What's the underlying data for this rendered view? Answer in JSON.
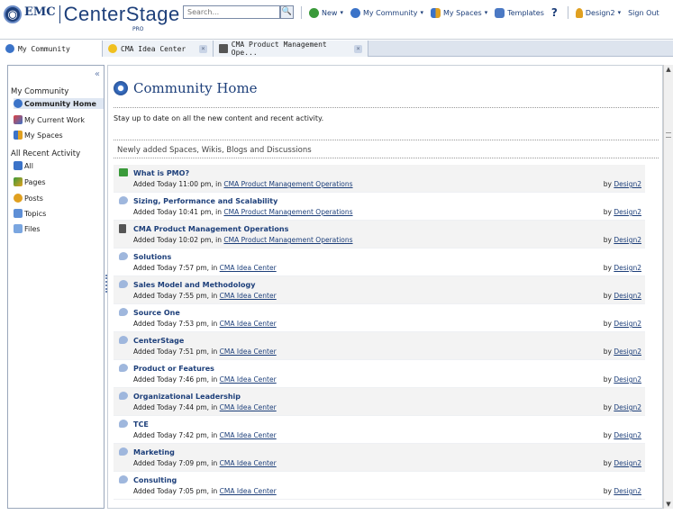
{
  "header": {
    "brand": "EMC",
    "product": "CenterStage",
    "edition": "PRO",
    "search_placeholder": "Search...",
    "search_button": "🔍",
    "nav": {
      "new": "New",
      "my_community": "My Community",
      "my_spaces": "My Spaces",
      "templates": "Templates",
      "help": "?",
      "user": "Design2",
      "sign_out": "Sign Out"
    }
  },
  "tabs": [
    {
      "label": "My Community"
    },
    {
      "label": "CMA Idea Center",
      "close": "×"
    },
    {
      "label": "CMA Product Management Ope...",
      "close": "×"
    }
  ],
  "sidebar": {
    "collapse": "«",
    "heading1": "My Community",
    "items1": [
      {
        "label": "Community Home"
      },
      {
        "label": "My Current Work"
      },
      {
        "label": "My Spaces"
      }
    ],
    "heading2": "All Recent Activity",
    "items2": [
      {
        "label": "All"
      },
      {
        "label": "Pages"
      },
      {
        "label": "Posts"
      },
      {
        "label": "Topics"
      },
      {
        "label": "Files"
      }
    ]
  },
  "main": {
    "title": "Community Home",
    "intro": "Stay up to date on all the new content and recent activity.",
    "section_title": "Newly added Spaces, Wikis, Blogs and Discussions",
    "rows": [
      {
        "title": "What is PMO?",
        "added": "Added Today 11:00 pm, in",
        "location": "CMA Product Management Operations",
        "by": "by",
        "author": "Design2"
      },
      {
        "title": "Sizing, Performance and Scalability",
        "added": "Added Today 10:41 pm, in",
        "location": "CMA Product Management Operations",
        "by": "by",
        "author": "Design2"
      },
      {
        "title": "CMA Product Management Operations",
        "added": "Added Today 10:02 pm, in",
        "location": "CMA Product Management Operations",
        "by": "by",
        "author": "Design2"
      },
      {
        "title": "Solutions",
        "added": "Added Today 7:57 pm, in",
        "location": "CMA Idea Center",
        "by": "by",
        "author": "Design2"
      },
      {
        "title": "Sales Model and Methodology",
        "added": "Added Today 7:55 pm, in",
        "location": "CMA Idea Center",
        "by": "by",
        "author": "Design2"
      },
      {
        "title": "Source One",
        "added": "Added Today 7:53 pm, in",
        "location": "CMA Idea Center",
        "by": "by",
        "author": "Design2"
      },
      {
        "title": "CenterStage",
        "added": "Added Today 7:51 pm, in",
        "location": "CMA Idea Center",
        "by": "by",
        "author": "Design2"
      },
      {
        "title": "Product or Features",
        "added": "Added Today 7:46 pm, in",
        "location": "CMA Idea Center",
        "by": "by",
        "author": "Design2"
      },
      {
        "title": "Organizational Leadership",
        "added": "Added Today 7:44 pm, in",
        "location": "CMA Idea Center",
        "by": "by",
        "author": "Design2"
      },
      {
        "title": "TCE",
        "added": "Added Today 7:42 pm, in",
        "location": "CMA Idea Center",
        "by": "by",
        "author": "Design2"
      },
      {
        "title": "Marketing",
        "added": "Added Today 7:09 pm, in",
        "location": "CMA Idea Center",
        "by": "by",
        "author": "Design2"
      },
      {
        "title": "Consulting",
        "added": "Added Today 7:05 pm, in",
        "location": "CMA Idea Center",
        "by": "by",
        "author": "Design2"
      }
    ]
  },
  "scrollbar": {
    "up": "▲",
    "down": "▼"
  }
}
